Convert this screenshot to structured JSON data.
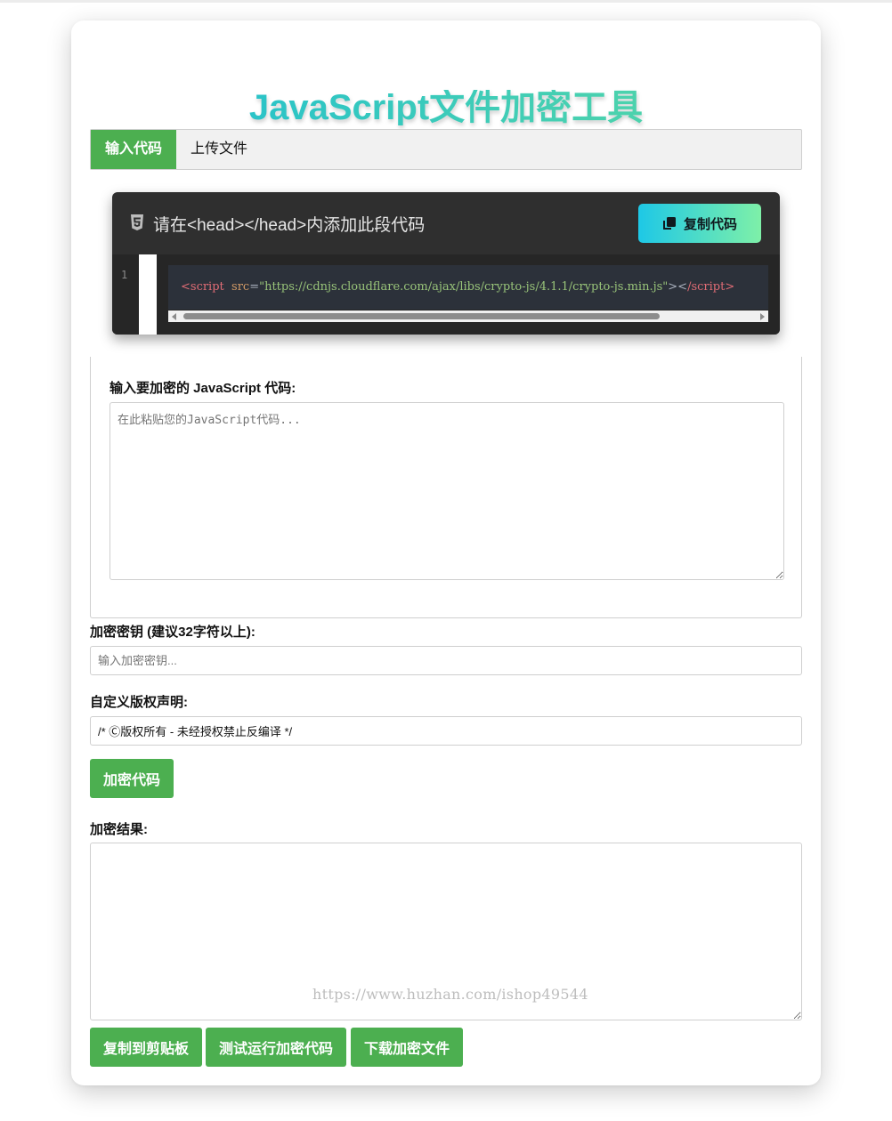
{
  "page": {
    "title": "JavaScript文件加密工具"
  },
  "tabs": [
    {
      "label": "输入代码",
      "active": true
    },
    {
      "label": "上传文件",
      "active": false
    }
  ],
  "code_snippet": {
    "header": "请在<head></head>内添加此段代码",
    "copy_button": "复制代码",
    "line_number": "1",
    "tokens": {
      "open": "<script",
      "attr": "src",
      "eq": "=",
      "value": "\"https://cdnjs.cloudflare.com/ajax/libs/crypto-js/4.1.1/crypto-js.min.js\"",
      "close": "><",
      "end_tag": "/script>"
    }
  },
  "js_input": {
    "label": "输入要加密的 JavaScript 代码:",
    "placeholder": "在此粘贴您的JavaScript代码..."
  },
  "key_input": {
    "label": "加密密钥 (建议32字符以上):",
    "placeholder": "输入加密密钥..."
  },
  "copyright_input": {
    "label": "自定义版权声明:",
    "value": "/* Ⓒ版权所有 - 未经授权禁止反编译 */"
  },
  "encrypt_button": "加密代码",
  "result": {
    "label": "加密结果:",
    "watermark": "https://www.huzhan.com/ishop49544"
  },
  "actions": {
    "copy": "复制到剪贴板",
    "test": "测试运行加密代码",
    "download": "下载加密文件"
  },
  "colors": {
    "primary_green": "#4caf50",
    "title_gradient_start": "#1bbdd4",
    "title_gradient_end": "#5cd9a0",
    "code_bg": "#2f2f2f"
  }
}
